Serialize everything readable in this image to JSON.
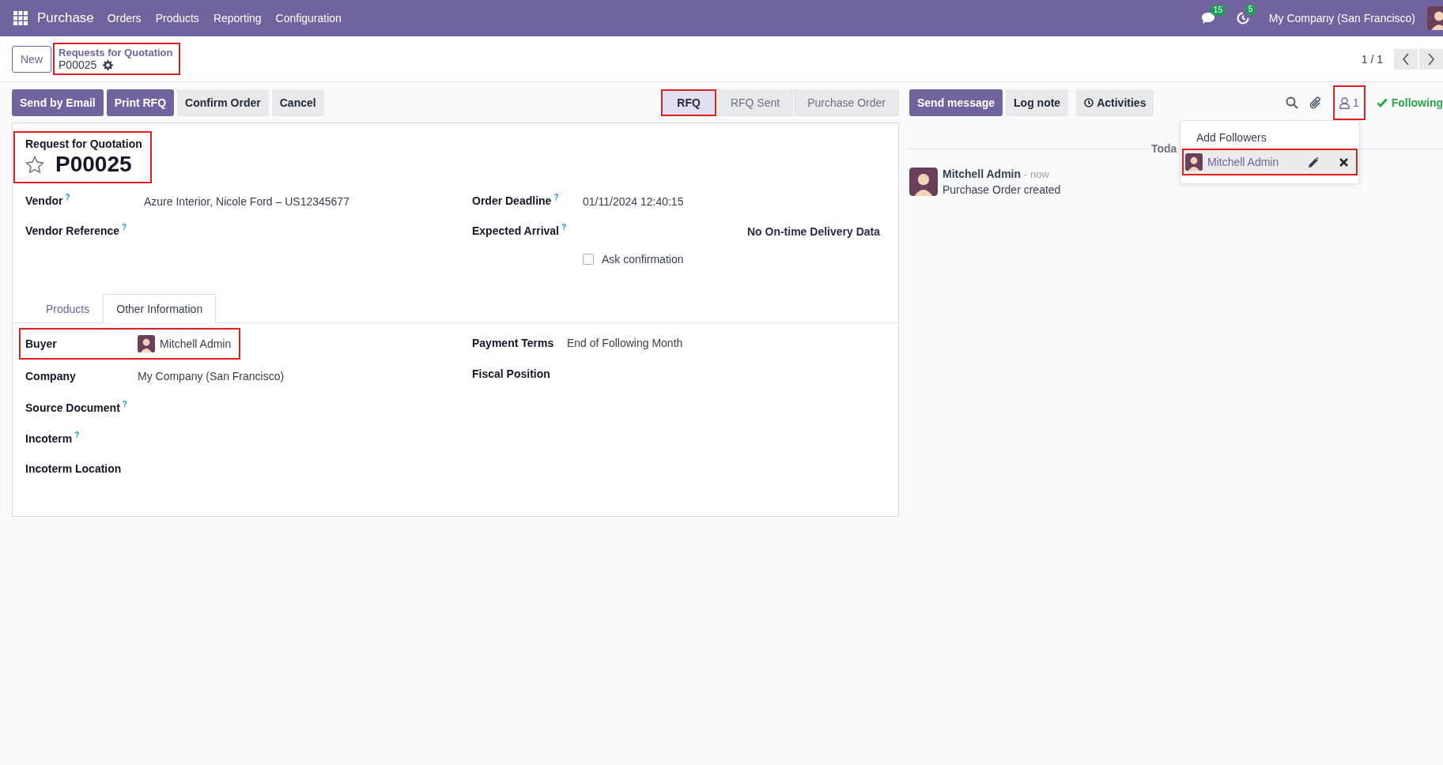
{
  "navbar": {
    "app": "Purchase",
    "menu": [
      "Orders",
      "Products",
      "Reporting",
      "Configuration"
    ],
    "messages_count": "15",
    "activities_count": "5",
    "company": "My Company (San Francisco)"
  },
  "control_panel": {
    "new_button": "New",
    "breadcrumb": {
      "parent": "Requests for Quotation",
      "current": "P00025",
      "highlighted": true
    },
    "pager": "1 / 1"
  },
  "actions": [
    {
      "label": "Send by Email",
      "primary": true
    },
    {
      "label": "Print RFQ",
      "primary": true
    },
    {
      "label": "Confirm Order",
      "primary": false
    },
    {
      "label": "Cancel",
      "primary": false
    }
  ],
  "statusbar": [
    {
      "label": "RFQ",
      "selected": true,
      "highlighted": true
    },
    {
      "label": "RFQ Sent",
      "selected": false,
      "highlighted": false
    },
    {
      "label": "Purchase Order",
      "selected": false,
      "highlighted": false
    }
  ],
  "sheet": {
    "subtitle": "Request for Quotation",
    "name": "P00025",
    "starred": false,
    "highlighted": true,
    "left_fields": [
      {
        "label": "Vendor",
        "help": "?",
        "value": "Azure Interior, Nicole Ford – US12345677"
      },
      {
        "label": "Vendor Reference",
        "help": "?"
      }
    ],
    "right_fields": [
      {
        "label": "Order Deadline",
        "help": "?",
        "value": "01/11/2024 12:40:15"
      },
      {
        "label": "Expected Arrival",
        "help": "?",
        "note": "No On-time Delivery Data"
      }
    ],
    "ask_confirmation": {
      "label": "Ask confirmation",
      "checked": false
    },
    "tabs": [
      {
        "label": "Products",
        "selected": false
      },
      {
        "label": "Other Information",
        "selected": true
      }
    ],
    "info_left": [
      {
        "label": "Buyer",
        "kind": "user",
        "value": "Mitchell Admin",
        "highlighted": true
      },
      {
        "label": "Company",
        "kind": "text",
        "value": "My Company (San Francisco)",
        "highlighted": false
      },
      {
        "label": "Source Document",
        "kind": "text",
        "help": "?",
        "highlighted": false
      },
      {
        "label": "Incoterm",
        "kind": "text",
        "help": "?",
        "highlighted": false
      },
      {
        "label": "Incoterm Location",
        "kind": "text",
        "highlighted": false
      }
    ],
    "info_right": [
      {
        "label": "Payment Terms",
        "value": "End of Following Month"
      },
      {
        "label": "Fiscal Position"
      }
    ]
  },
  "chatter": {
    "buttons": [
      {
        "label": "Send message",
        "primary": true
      },
      {
        "label": "Log note",
        "primary": false
      },
      {
        "label": "Activities",
        "primary": false
      }
    ],
    "followers_count": "1",
    "followers_highlighted": true,
    "following": "Following",
    "divider": "Toda",
    "messages": [
      {
        "author": "Mitchell Admin",
        "time": "- now",
        "body": "Purchase Order created"
      }
    ],
    "followers_menu": {
      "add": "Add Followers",
      "followers": [
        {
          "name": "Mitchell Admin",
          "highlighted": true
        }
      ]
    }
  }
}
